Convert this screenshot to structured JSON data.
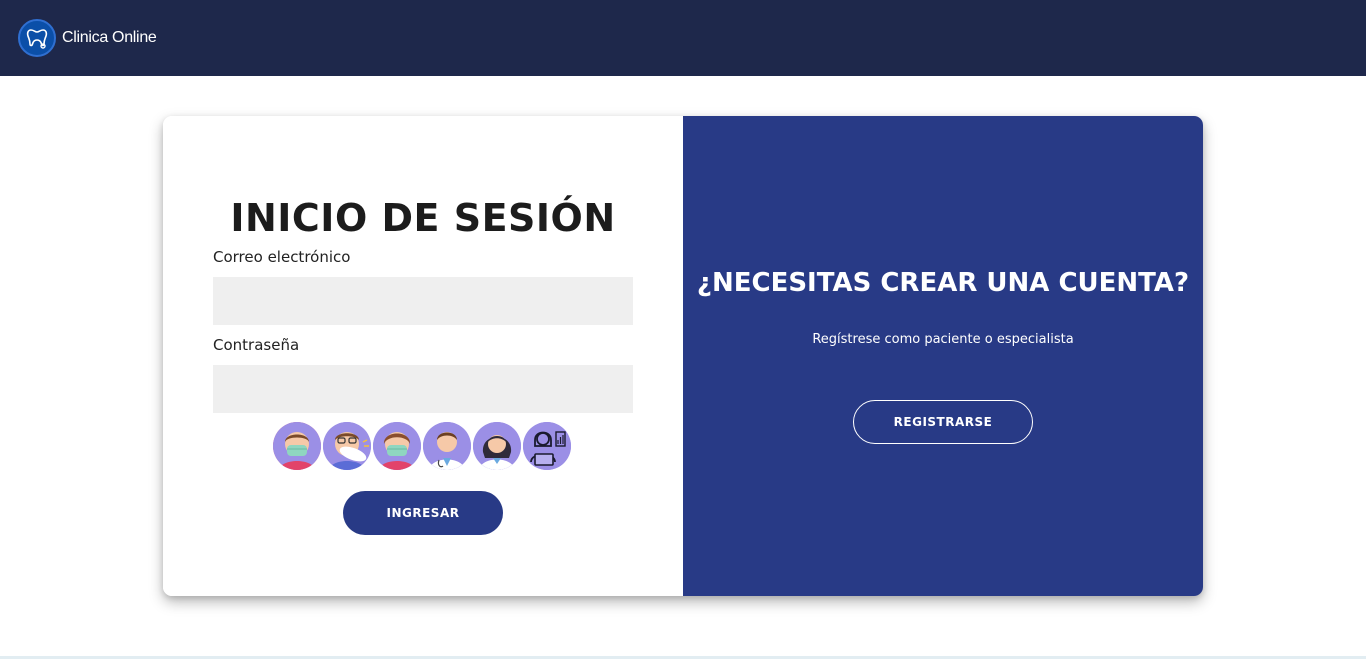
{
  "navbar": {
    "brand_name": "Clinica Online",
    "logo_icon": "tooth-stethoscope-icon",
    "background": "#1e284b"
  },
  "login": {
    "title": "INICIO DE SESIÓN",
    "email_label": "Correo electrónico",
    "email_value": "",
    "password_label": "Contraseña",
    "password_value": "",
    "quick_access_avatars": [
      "patient-masked-male-icon",
      "patient-sneezing-glasses-icon",
      "patient-masked-female-icon",
      "doctor-male-icon",
      "doctor-female-icon",
      "admin-laptop-icon"
    ],
    "submit_label": "INGRESAR"
  },
  "register": {
    "title": "¿NECESITAS CREAR UNA CUENTA?",
    "subtitle": "Regístrese como paciente o especialista",
    "button_label": "REGISTRARSE"
  },
  "colors": {
    "navbar": "#1e284b",
    "accent": "#283a86",
    "input_bg": "#efefef",
    "avatar_bg": "#9b8fe6"
  }
}
